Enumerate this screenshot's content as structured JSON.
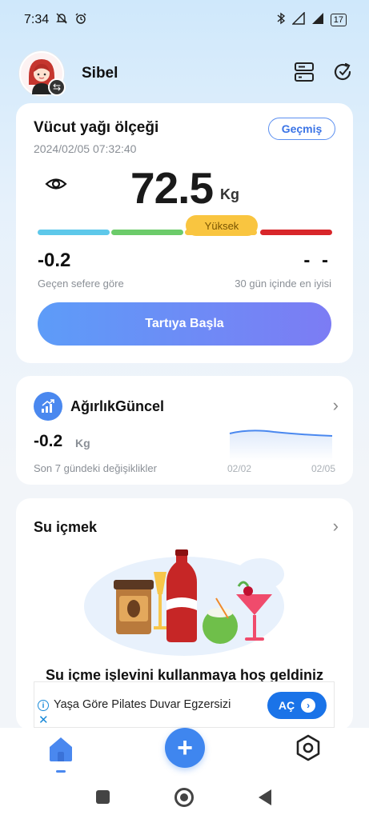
{
  "status_bar": {
    "time": "7:34",
    "battery": "17"
  },
  "header": {
    "username": "Sibel"
  },
  "scale_card": {
    "title": "Vücut yağı ölçeği",
    "date": "2024/02/05 07:32:40",
    "history_label": "Geçmiş",
    "weight": "72.5",
    "unit": "Kg",
    "level": "Yüksek",
    "level_colors": [
      "#5ec8ea",
      "#6ccb6a",
      "#f9c540",
      "#d8262a"
    ],
    "change_value": "-0.2",
    "change_label": "Geçen sefere göre",
    "best_value": "- -",
    "best_label": "30 gün içinde en iyisi",
    "start_label": "Tartıya Başla"
  },
  "trend_card": {
    "title": "AğırlıkGüncel",
    "value": "-0.2",
    "unit": "Kg",
    "label": "Son 7 gündeki değişiklikler",
    "start_date": "02/02",
    "end_date": "02/05"
  },
  "water_card": {
    "title": "Su içmek",
    "welcome": "Su içme işlevini kullanmaya hoş geldiniz"
  },
  "ad": {
    "text": "Yaşa Göre Pilates Duvar Egzersizi",
    "button_label": "AÇ"
  }
}
